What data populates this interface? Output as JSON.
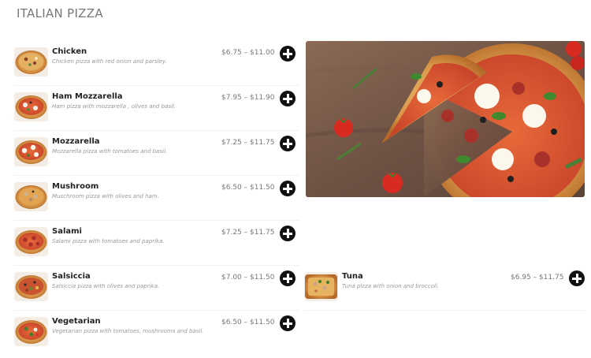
{
  "section": {
    "title": "ITALIAN PIZZA"
  },
  "menu": {
    "items": [
      {
        "name": "Chicken",
        "description": "Chicken pizza with red onion and parsley.",
        "price": "$6.75 – $11.00",
        "icon": "chicken-pizza-thumbnail"
      },
      {
        "name": "Ham Mozzarella",
        "description": "Ham pizza with mozzarella , olives and basil.",
        "price": "$7.95 – $11.90",
        "icon": "ham-mozzarella-pizza-thumbnail"
      },
      {
        "name": "Mozzarella",
        "description": "Mozzarella pizza with tomatoes and basil.",
        "price": "$7.25 – $11.75",
        "icon": "mozzarella-pizza-thumbnail"
      },
      {
        "name": "Mushroom",
        "description": "Muschroom pizza with olives and ham.",
        "price": "$6.50 – $11.50",
        "icon": "mushroom-pizza-thumbnail"
      },
      {
        "name": "Salami",
        "description": "Salami pizza with tomatoes and paprika.",
        "price": "$7.25 – $11.75",
        "icon": "salami-pizza-thumbnail"
      },
      {
        "name": "Salsiccia",
        "description": "Salsiccia pizza with olives and paprika.",
        "price": "$7.00 – $11.50",
        "icon": "salsiccia-pizza-thumbnail"
      },
      {
        "name": "Vegetarian",
        "description": "Vegetarian pizza with tomatoes, mushrooms and basil.",
        "price": "$6.50 – $11.50",
        "icon": "vegetarian-pizza-thumbnail"
      },
      {
        "name": "Tuna",
        "description": "Tuna pizza with onion and broccoli.",
        "price": "$6.95 – $11.75",
        "icon": "tuna-pizza-thumbnail"
      }
    ]
  },
  "hero": {
    "icon": "sliced-pizza-photo"
  },
  "colors": {
    "title": "#777777",
    "add_button": "#111111",
    "divider": "#f1f1f1"
  }
}
